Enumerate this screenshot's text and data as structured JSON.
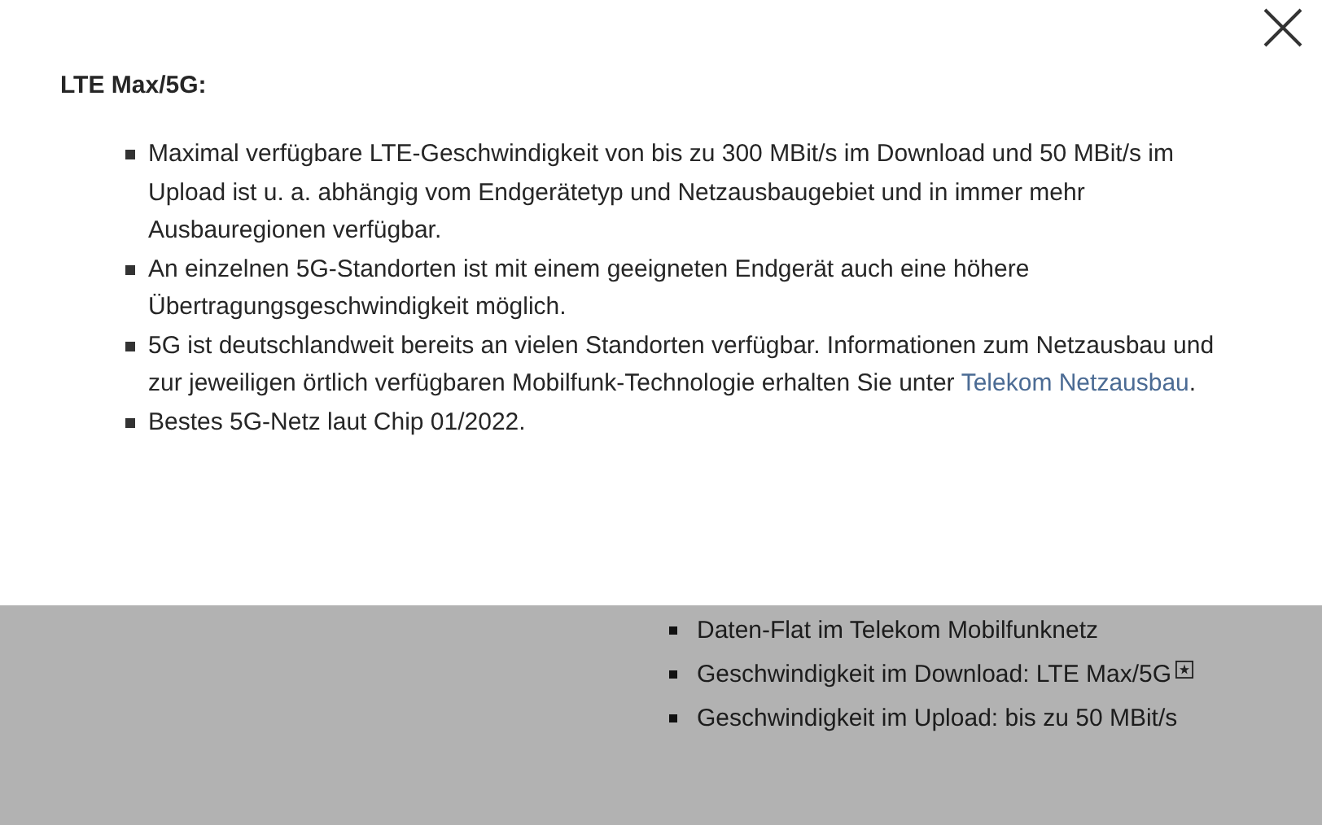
{
  "modal": {
    "heading": "LTE Max/5G:",
    "items": [
      {
        "text": "Maximal verfügbare LTE-Geschwindigkeit von bis zu 300 MBit/s im Download und 50 MBit/s im Upload ist u. a. abhängig vom Endgerätetyp und Netzausbaugebiet und in immer mehr Ausbauregionen verfügbar."
      },
      {
        "text": "An einzelnen 5G-Standorten ist mit einem geeigneten Endgerät auch eine höhere Übertragungsgeschwindigkeit möglich."
      },
      {
        "text": "5G ist deutschlandweit bereits an vielen Standorten verfügbar. Informationen zum Netzausbau und zur jeweiligen örtlich verfügbaren Mobilfunk-Technologie erhalten Sie unter",
        "link": "Telekom Netzausbau",
        "after": "."
      },
      {
        "text": "Bestes 5G-Netz laut Chip 01/2022."
      }
    ]
  },
  "background": {
    "features": [
      {
        "text": "Daten-Flat im Telekom Mobilfunknetz",
        "footnote": false
      },
      {
        "text": "Geschwindigkeit im Download: LTE Max/5G",
        "footnote": true
      },
      {
        "text": "Geschwindigkeit im Upload: bis zu 50 MBit/s",
        "footnote": false
      }
    ]
  }
}
